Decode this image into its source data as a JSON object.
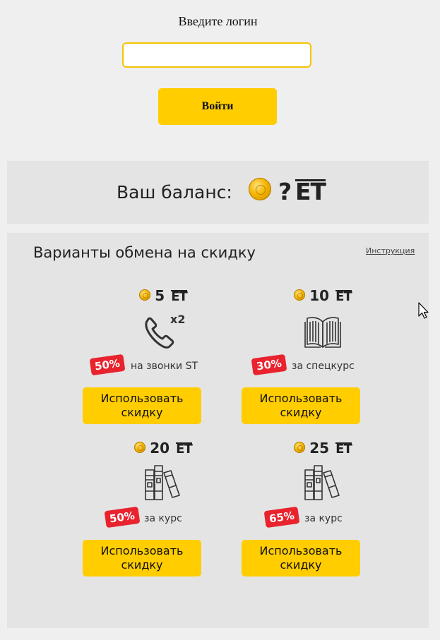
{
  "login": {
    "title": "Введите логин",
    "input_value": "",
    "input_placeholder": "",
    "button_label": "Войти"
  },
  "balance": {
    "label": "Ваш баланс:",
    "value": "?",
    "currency": "ET"
  },
  "exchange": {
    "title": "Варианты обмена на скидку",
    "help_link": "Инструкция",
    "offers": [
      {
        "price": "5",
        "currency": "ET",
        "icon": "phone-x2-icon",
        "icon_badge": "x2",
        "discount": "50%",
        "description": "на звонки ST",
        "button_label": "Использовать скидку"
      },
      {
        "price": "10",
        "currency": "ET",
        "icon": "open-book-icon",
        "discount": "30%",
        "description": "за спецкурс",
        "button_label": "Использовать скидку"
      },
      {
        "price": "20",
        "currency": "ET",
        "icon": "books-icon",
        "discount": "50%",
        "description": "за курс",
        "button_label": "Использовать скидку"
      },
      {
        "price": "25",
        "currency": "ET",
        "icon": "books-icon",
        "discount": "65%",
        "description": "за курс",
        "button_label": "Использовать скидку"
      }
    ]
  },
  "colors": {
    "accent_yellow": "#ffcd00",
    "badge_red": "#e8232e",
    "panel_gray": "#e4e4e4",
    "page_bg": "#efefef"
  }
}
